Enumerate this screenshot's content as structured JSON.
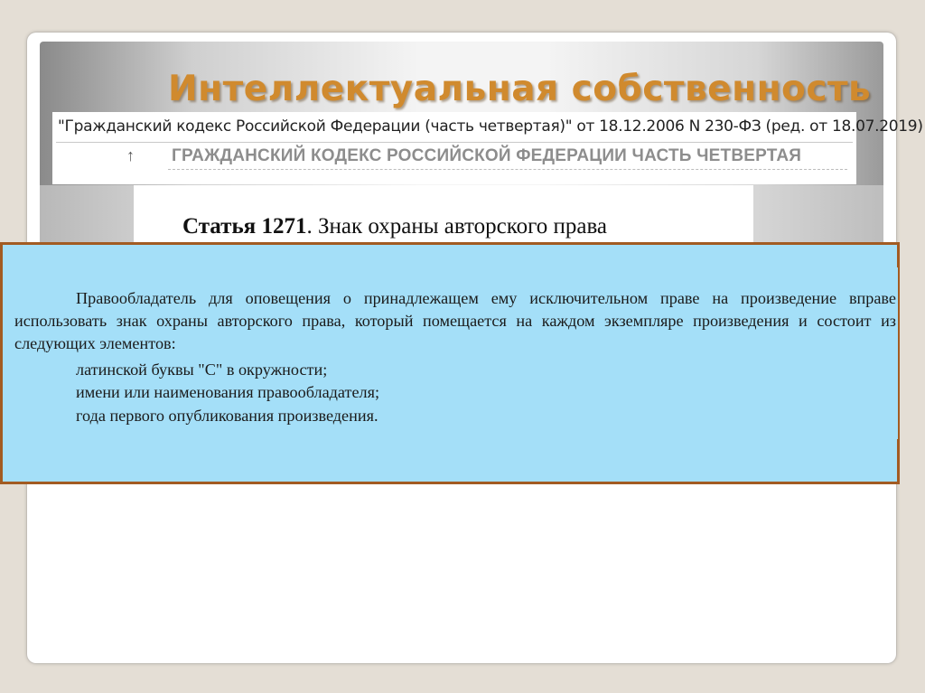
{
  "slide": {
    "title": "Интеллектуальная собственность"
  },
  "document": {
    "reference": "\"Гражданский кодекс Российской Федерации (часть четвертая)\" от 18.12.2006 N 230-ФЗ (ред. от 18.07.2019)",
    "up_arrow": "↑",
    "section_heading": "ГРАЖДАНСКИЙ КОДЕКС РОССИЙСКОЙ ФЕДЕРАЦИИ ЧАСТЬ ЧЕТВЕРТАЯ"
  },
  "article": {
    "number": "Статья 1271",
    "title_rest": ". Знак охраны авторского права"
  },
  "content": {
    "paragraph": "Правообладатель для оповещения о принадлежащем ему исключительном праве на произведение вправе использовать знак охраны авторского права, который помещается на каждом экземпляре произведения и состоит из следующих элементов:",
    "items": [
      "латинской буквы \"C\" в окружности;",
      "имени или наименования правообладателя;",
      "года первого опубликования произведения."
    ]
  },
  "colors": {
    "title": "#d08a2e",
    "highlight_fill": "#a4dff8",
    "highlight_border": "#a25b22"
  }
}
